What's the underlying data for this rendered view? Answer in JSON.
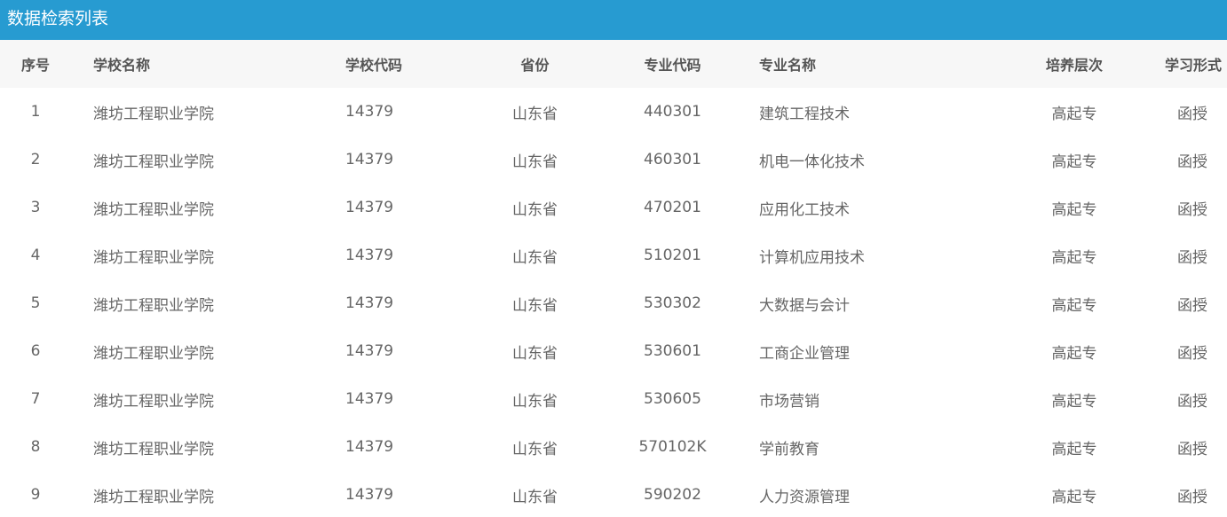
{
  "panel": {
    "title": "数据检索列表"
  },
  "table": {
    "headers": {
      "index": "序号",
      "school_name": "学校名称",
      "school_code": "学校代码",
      "province": "省份",
      "major_code": "专业代码",
      "major_name": "专业名称",
      "level": "培养层次",
      "study_form": "学习形式"
    },
    "rows": [
      {
        "index": "1",
        "school_name": "潍坊工程职业学院",
        "school_code": "14379",
        "province": "山东省",
        "major_code": "440301",
        "major_name": "建筑工程技术",
        "level": "高起专",
        "study_form": "函授"
      },
      {
        "index": "2",
        "school_name": "潍坊工程职业学院",
        "school_code": "14379",
        "province": "山东省",
        "major_code": "460301",
        "major_name": "机电一体化技术",
        "level": "高起专",
        "study_form": "函授"
      },
      {
        "index": "3",
        "school_name": "潍坊工程职业学院",
        "school_code": "14379",
        "province": "山东省",
        "major_code": "470201",
        "major_name": "应用化工技术",
        "level": "高起专",
        "study_form": "函授"
      },
      {
        "index": "4",
        "school_name": "潍坊工程职业学院",
        "school_code": "14379",
        "province": "山东省",
        "major_code": "510201",
        "major_name": "计算机应用技术",
        "level": "高起专",
        "study_form": "函授"
      },
      {
        "index": "5",
        "school_name": "潍坊工程职业学院",
        "school_code": "14379",
        "province": "山东省",
        "major_code": "530302",
        "major_name": "大数据与会计",
        "level": "高起专",
        "study_form": "函授"
      },
      {
        "index": "6",
        "school_name": "潍坊工程职业学院",
        "school_code": "14379",
        "province": "山东省",
        "major_code": "530601",
        "major_name": "工商企业管理",
        "level": "高起专",
        "study_form": "函授"
      },
      {
        "index": "7",
        "school_name": "潍坊工程职业学院",
        "school_code": "14379",
        "province": "山东省",
        "major_code": "530605",
        "major_name": "市场营销",
        "level": "高起专",
        "study_form": "函授"
      },
      {
        "index": "8",
        "school_name": "潍坊工程职业学院",
        "school_code": "14379",
        "province": "山东省",
        "major_code": "570102K",
        "major_name": "学前教育",
        "level": "高起专",
        "study_form": "函授"
      },
      {
        "index": "9",
        "school_name": "潍坊工程职业学院",
        "school_code": "14379",
        "province": "山东省",
        "major_code": "590202",
        "major_name": "人力资源管理",
        "level": "高起专",
        "study_form": "函授"
      }
    ]
  },
  "colors": {
    "header_bar": "#279bd1",
    "table_head_bg": "#f7f7f7"
  }
}
